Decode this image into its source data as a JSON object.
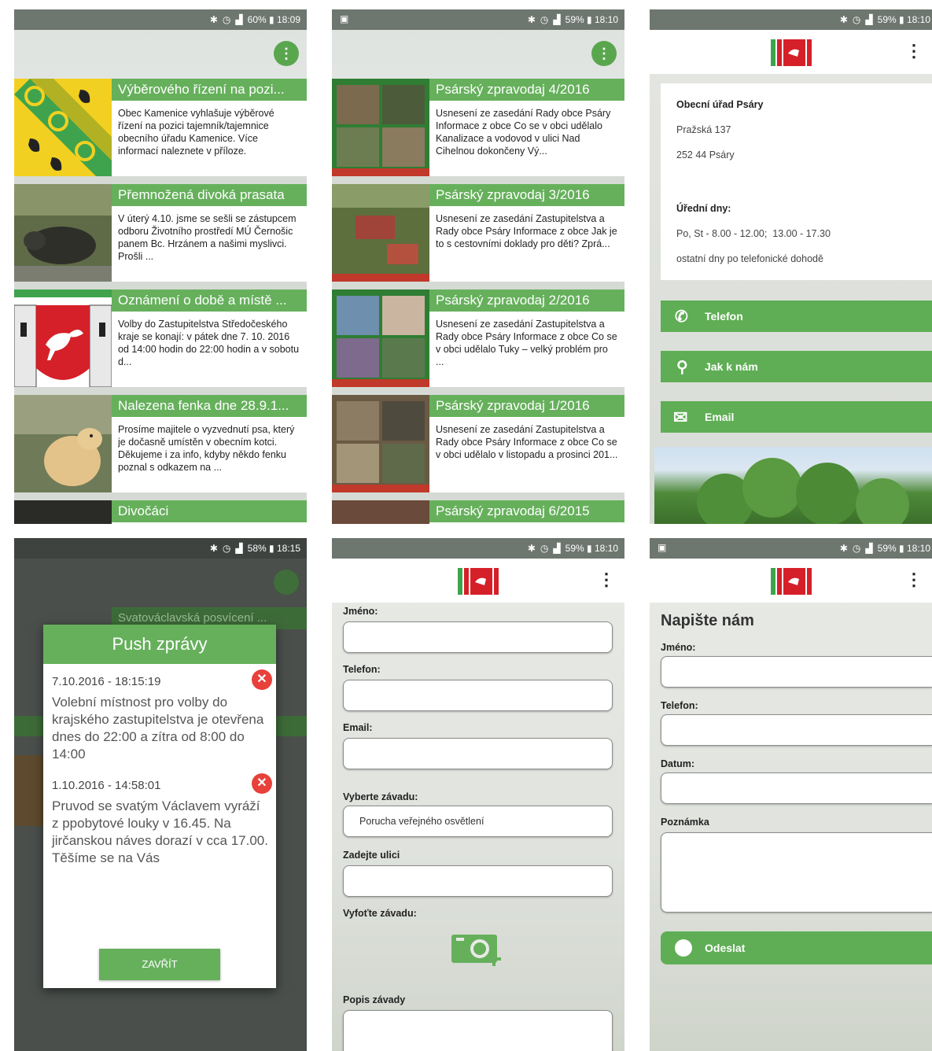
{
  "status_bars": {
    "s1": {
      "time": "18:09",
      "battery": "60%"
    },
    "s2": {
      "time": "18:10",
      "battery": "59%"
    },
    "s3": {
      "time": "18:10",
      "battery": "59%"
    },
    "s4": {
      "time": "18:15",
      "battery": "58%"
    },
    "s5": {
      "time": "18:10",
      "battery": "59%"
    },
    "s6": {
      "time": "18:10",
      "battery": "59%"
    }
  },
  "news": [
    {
      "title": "Výběrového řízení na pozi...",
      "desc": "Obec Kamenice vyhlašuje výběrové řízení na pozici tajemník/tajemnice obecního úřadu Kamenice. Více informací naleznete v příloze."
    },
    {
      "title": "Přemnožená divoká prasata",
      "desc": "V úterý 4.10. jsme se sešli se zástupcem odboru Životního prostředí MÚ Černošic panem Bc. Hrzánem a našimi myslivci. Prošli ..."
    },
    {
      "title": "Oznámení o době a místě ...",
      "desc": "Volby do Zastupitelstva Středočeského kraje se konají: v pátek dne 7. 10. 2016 od 14:00 hodin do 22:00 hodin a v sobotu d..."
    },
    {
      "title": "Nalezena fenka dne 28.9.1...",
      "desc": "Prosíme majitele o vyzvednutí psa, který je dočasně umístěn v obecním kotci. Děkujeme i za info, kdyby někdo fenku poznal s odkazem na ..."
    },
    {
      "title": "Divočáci",
      "desc": ""
    }
  ],
  "zpravodaj": [
    {
      "title": "Psárský zpravodaj 4/2016",
      "desc": "Usnesení ze zasedání Rady obce Psáry Informace z obce Co se v obci udělalo Kanalizace a vodovod v ulici Nad Cihelnou dokončeny Vý..."
    },
    {
      "title": "Psárský zpravodaj 3/2016",
      "desc": "Usnesení ze zasedání Zastupitelstva a Rady obce Psáry Informace z obce Jak je to s cestovními doklady pro děti? Zprá..."
    },
    {
      "title": "Psárský zpravodaj 2/2016",
      "desc": "Usnesení ze zasedání Zastupitelstva a Rady obce Psáry Informace z obce Co se v obci udělalo Tuky – velký problém pro ..."
    },
    {
      "title": "Psárský zpravodaj 1/2016",
      "desc": "Usnesení ze zasedání Zastupitelstva a Rady obce Psáry Informace z obce Co se v obci udělalo v listopadu a prosinci 201..."
    },
    {
      "title": "Psárský zpravodaj 6/2015",
      "desc": ""
    }
  ],
  "contact": {
    "name": "Obecní úřad Psáry",
    "street": "Pražská 137",
    "city": "252 44 Psáry",
    "hours_label": "Úřední dny:",
    "hours": "Po, St - 8.00 - 12.00;  13.00 - 17.30",
    "other": "ostatní dny po telefonické dohodě",
    "btn_phone": "Telefon",
    "btn_map": "Jak k nám",
    "btn_email": "Email"
  },
  "push": {
    "bg_title": "Svatováclavská posvícení ...",
    "title": "Push zprávy",
    "m1_date": "7.10.2016 - 18:15:19",
    "m1_text": "Volební místnost pro volby do krajského zastupitelstva je otevřena dnes do 22:00 a zítra od 8:00 do 14:00",
    "m2_date": "1.10.2016 - 14:58:01",
    "m2_text": "Pruvod se svatým Václavem vyráží z ppobytové louky v 16.45. Na jirčanskou náves dorazí v cca 17.00. Těšíme se na Vás",
    "close": "ZAVŘÍT"
  },
  "defect": {
    "name": "Jméno:",
    "phone": "Telefon:",
    "email": "Email:",
    "choose": "Vyberte závadu:",
    "choose_value": "Porucha veřejného osvětlení",
    "street": "Zadejte ulici",
    "photo": "Vyfoťte závadu:",
    "desc": "Popis závady"
  },
  "message": {
    "heading": "Napište nám",
    "name": "Jméno:",
    "phone": "Telefon:",
    "date": "Datum:",
    "note": "Poznámka",
    "send": "Odeslat"
  },
  "colors": {
    "green": "#66b05c",
    "status": "#6e7670"
  }
}
